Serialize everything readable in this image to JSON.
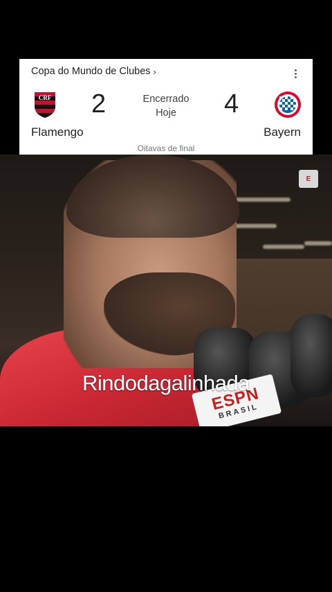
{
  "scorecard": {
    "competition": "Copa do Mundo de Clubes",
    "chevron": "›",
    "menu_icon": "more-vert-icon",
    "home_team": "Flamengo",
    "away_team": "Bayern",
    "home_score": "2",
    "away_score": "4",
    "status": "Encerrado",
    "date": "Hoje",
    "round": "Oitavas de final",
    "home_crest_colors": [
      "#c8102e",
      "#111111"
    ],
    "away_crest_colors": [
      "#dc052d",
      "#0066b2",
      "#ffffff"
    ]
  },
  "video": {
    "caption": "Rindodagalinhada",
    "mic_brand": "ESPN",
    "mic_sub": "BRASIL",
    "channel_bug": "E"
  }
}
